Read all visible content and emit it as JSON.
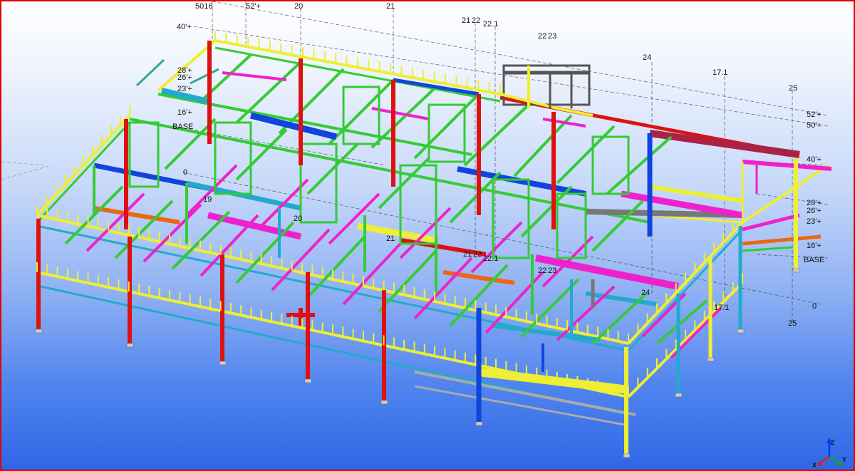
{
  "grid_labels": {
    "top": [
      "5016",
      "52'+",
      "20",
      "21",
      "21",
      "22",
      "22.1",
      "22",
      "23",
      "24",
      "17.1",
      "25"
    ],
    "left": [
      "40'+",
      "28'+",
      "26'+",
      "23'+",
      "16'+",
      "BASE",
      "0"
    ],
    "right": [
      "52'+",
      "50'+",
      "40'+",
      "28'+",
      "26'+",
      "23'+",
      "16'+",
      "BASE",
      "0"
    ],
    "mid": [
      "19",
      "20",
      "21",
      "21",
      "22",
      "22.1",
      "22",
      "23",
      "24",
      "17.1",
      "25"
    ]
  },
  "axes": {
    "x": "X",
    "y": "Y",
    "z": "Z"
  },
  "colors": {
    "frame_border": "#e00000",
    "bg_top": "#ffffff",
    "bg_bottom": "#2f66e6",
    "member_green": "#33cc33",
    "member_yellow": "#eeee33",
    "member_red": "#dd1111",
    "member_blue": "#1144dd",
    "member_cyan": "#22aacc",
    "member_magenta": "#ee22cc",
    "member_orange": "#ee6611",
    "member_gray": "#777777"
  }
}
